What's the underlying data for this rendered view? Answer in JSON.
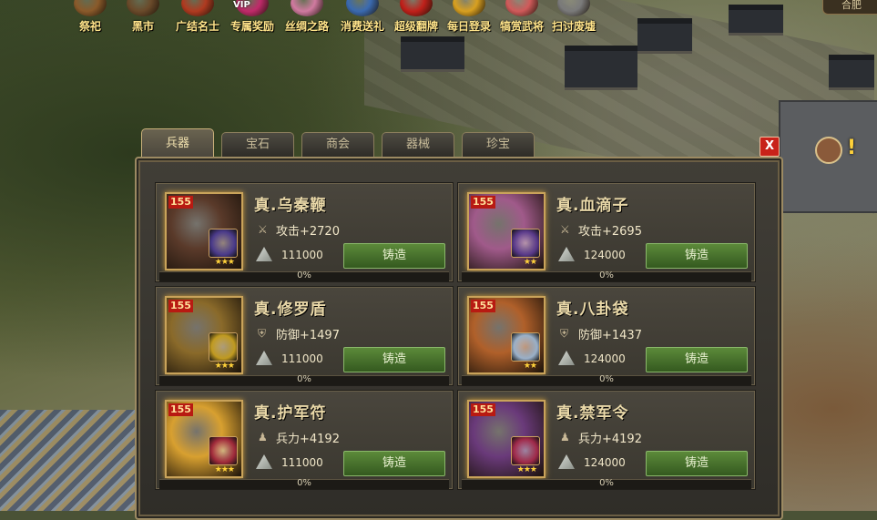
{
  "topbar": {
    "items": [
      {
        "label": "祭祀",
        "icon": "helmet-icon",
        "color": "#8a5a2a"
      },
      {
        "label": "黑市",
        "icon": "merchant-icon",
        "color": "#6a4a2a"
      },
      {
        "label": "广结名士",
        "icon": "scholar-icon",
        "color": "#b03a20"
      },
      {
        "label": "专属奖励",
        "icon": "vip-chest-icon",
        "color": "#c02a6a",
        "tag": "VIP"
      },
      {
        "label": "丝绸之路",
        "icon": "silk-icon",
        "color": "#d07aa0"
      },
      {
        "label": "消费送礼",
        "icon": "gift-icon",
        "color": "#3a6ab0"
      },
      {
        "label": "超级翻牌",
        "icon": "card-icon",
        "color": "#c0201a"
      },
      {
        "label": "每日登录",
        "icon": "gold-coins-icon",
        "color": "#d8a020"
      },
      {
        "label": "犒赏武将",
        "icon": "reward-icon",
        "color": "#d05a5a"
      },
      {
        "label": "扫讨废墟",
        "icon": "ruins-icon",
        "color": "#7a7a7a"
      }
    ],
    "corner_button": "合肥"
  },
  "tabs": [
    "兵器",
    "宝石",
    "商会",
    "器械",
    "珍宝"
  ],
  "active_tab": 0,
  "close_label": "X",
  "items": [
    {
      "level": "155",
      "name": "真.乌秦鞭",
      "stat_icon": "sword-icon",
      "stat": "攻击+2720",
      "cost": "111000",
      "button": "铸造",
      "progress_label": "0%",
      "progress": 0,
      "thumb_color": "#5a3a2a",
      "gem_color": "#4a3a8a",
      "stars": "★★★"
    },
    {
      "level": "155",
      "name": "真.血滴子",
      "stat_icon": "sword-icon",
      "stat": "攻击+2695",
      "cost": "124000",
      "button": "铸造",
      "progress_label": "0%",
      "progress": 0,
      "thumb_color": "#a05a8a",
      "gem_color": "#5a3a8a",
      "stars": "★★"
    },
    {
      "level": "155",
      "name": "真.修罗盾",
      "stat_icon": "shield-icon",
      "stat": "防御+1497",
      "cost": "111000",
      "button": "铸造",
      "progress_label": "0%",
      "progress": 0,
      "thumb_color": "#8a6a2a",
      "gem_color": "#c09a20",
      "stars": "★★★"
    },
    {
      "level": "155",
      "name": "真.八卦袋",
      "stat_icon": "shield-icon",
      "stat": "防御+1437",
      "cost": "124000",
      "button": "铸造",
      "progress_label": "0%",
      "progress": 0,
      "thumb_color": "#b0602a",
      "gem_color": "#9ab0c8",
      "stars": "★★"
    },
    {
      "level": "155",
      "name": "真.护军符",
      "stat_icon": "soldier-icon",
      "stat": "兵力+4192",
      "cost": "111000",
      "button": "铸造",
      "progress_label": "0%",
      "progress": 0,
      "thumb_color": "#d8a030",
      "gem_color": "#a02a3a",
      "stars": "★★★"
    },
    {
      "level": "155",
      "name": "真.禁军令",
      "stat_icon": "soldier-icon",
      "stat": "兵力+4192",
      "cost": "124000",
      "button": "铸造",
      "progress_label": "0%",
      "progress": 0,
      "thumb_color": "#6a3a7a",
      "gem_color": "#a02a4a",
      "stars": "★★★"
    }
  ]
}
